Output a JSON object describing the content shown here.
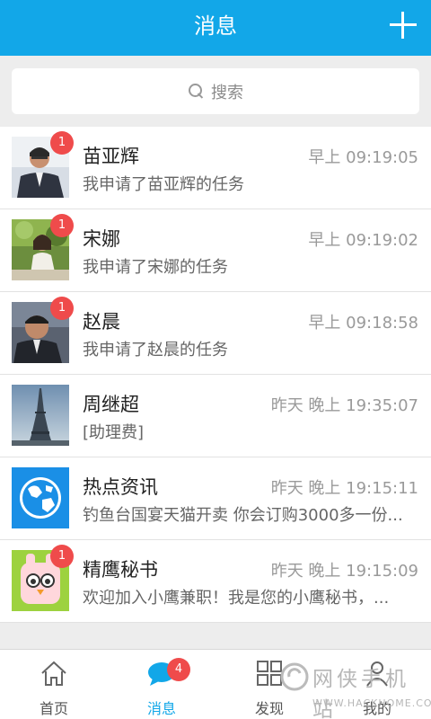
{
  "header": {
    "title": "消息",
    "add_icon": "plus-icon"
  },
  "search": {
    "label": "搜索",
    "icon": "search-icon"
  },
  "messages": [
    {
      "name": "苗亚辉",
      "time": "早上 09:19:05",
      "preview": "我申请了苗亚辉的任务",
      "badge": "1",
      "avatar": "person-photo"
    },
    {
      "name": "宋娜",
      "time": "早上 09:19:02",
      "preview": "我申请了宋娜的任务",
      "badge": "1",
      "avatar": "person-photo"
    },
    {
      "name": "赵晨",
      "time": "早上 09:18:58",
      "preview": "我申请了赵晨的任务",
      "badge": "1",
      "avatar": "person-photo"
    },
    {
      "name": "周继超",
      "time": "昨天  晚上 19:35:07",
      "preview": "[助理费]",
      "badge": "",
      "avatar": "eiffel-tower-photo"
    },
    {
      "name": "热点资讯",
      "time": "昨天  晚上 19:15:11",
      "preview": "钓鱼台国宴天猫开卖 你会订购3000多一份...",
      "badge": "",
      "avatar": "globe-icon"
    },
    {
      "name": "精鹰秘书",
      "time": "昨天  晚上 19:15:09",
      "preview": "欢迎加入小鹰兼职！我是您的小鹰秘书，...",
      "badge": "1",
      "avatar": "mascot-icon"
    }
  ],
  "tabbar": {
    "tabs": [
      {
        "label": "首页",
        "icon": "home-icon"
      },
      {
        "label": "消息",
        "icon": "chat-icon",
        "badge": "4"
      },
      {
        "label": "发现",
        "icon": "grid-icon"
      },
      {
        "label": "我的",
        "icon": "person-icon"
      }
    ]
  },
  "watermark": {
    "title": "网侠手机站",
    "url": "WWW.HACKHOME.COM"
  },
  "colors": {
    "accent": "#12a7e8",
    "badge": "#ef4b4b",
    "background": "#ededed"
  }
}
